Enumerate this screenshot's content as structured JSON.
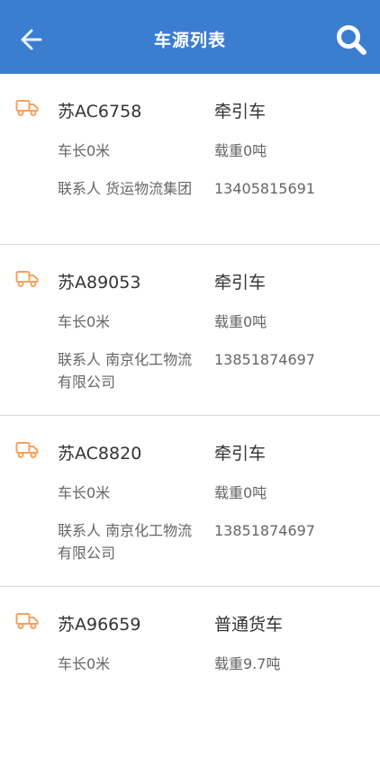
{
  "header": {
    "title": "车源列表",
    "back_icon": "arrow-left-icon",
    "search_icon": "search-icon"
  },
  "colors": {
    "header_bg": "#3b7ed0",
    "truck_icon": "#f5a25d",
    "divider": "#d8d8d8"
  },
  "vehicles": [
    {
      "plate": "苏AC6758",
      "type": "牵引车",
      "length": "车长0米",
      "load": "载重0吨",
      "contact": "联系人 货运物流集团",
      "phone": "13405815691"
    },
    {
      "plate": "苏A89053",
      "type": "牵引车",
      "length": "车长0米",
      "load": "载重0吨",
      "contact": "联系人 南京化工物流有限公司",
      "phone": "13851874697"
    },
    {
      "plate": "苏AC8820",
      "type": "牵引车",
      "length": "车长0米",
      "load": "载重0吨",
      "contact": "联系人 南京化工物流有限公司",
      "phone": "13851874697"
    },
    {
      "plate": "苏A96659",
      "type": "普通货车",
      "length": "车长0米",
      "load": "载重9.7吨",
      "contact": "",
      "phone": ""
    }
  ]
}
